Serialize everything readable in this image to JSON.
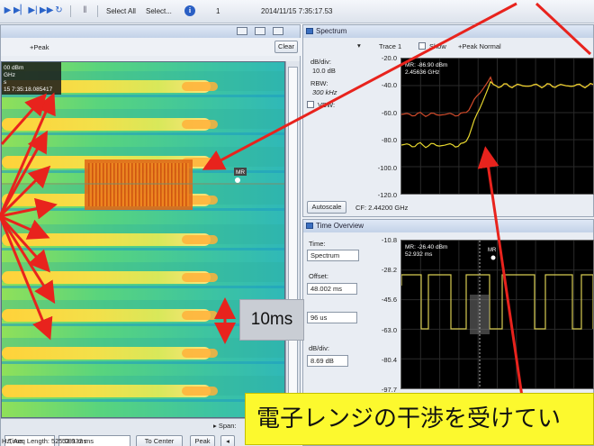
{
  "toolbar": {
    "select_all": "Select All",
    "select": "Select...",
    "index": "1",
    "timestamp": "2014/11/15 7:35:17.53"
  },
  "spectrogram": {
    "peak_label": "+Peak",
    "clear_button": "Clear",
    "marker_readout": [
      "00 dBm",
      "GHz",
      "s",
      "15 7:35:18.085417"
    ],
    "marker_tag": "MR",
    "bottom": {
      "span_label": "▸ Span:",
      "mode_value": "Time",
      "time_value": "52.932 ms",
      "to_center": "To Center",
      "peak_button": "Peak",
      "status": "Hz, Acq Length: 525.081 ms"
    }
  },
  "spectrum": {
    "title": "Spectrum",
    "trace_label": "Trace 1",
    "show_label": "Show",
    "detection": "+Peak Normal",
    "db_div_label": "dB/div:",
    "db_div_value": "10.0 dB",
    "rbw_label": "RBW:",
    "rbw_value": "300 kHz",
    "vbw_label": "VBW:",
    "autoscale_button": "Autoscale",
    "cf_label": "CF: 2.44200 GHz",
    "marker_readout": [
      "MR: -86.90 dBm",
      "2.45636 GHz"
    ],
    "y_ticks": [
      "-20.0",
      "-40.0",
      "-60.0",
      "-80.0",
      "-100.0",
      "-120.0"
    ]
  },
  "time_overview": {
    "title": "Time Overview",
    "time_label": "Time:",
    "time_select": "Spectrum",
    "offset_label": "Offset:",
    "offset_value": "48.002 ms",
    "length_value": "96 us",
    "db_div_label": "dB/div:",
    "db_div_value": "8.69 dB",
    "marker_readout": [
      "MR: -26.40 dBm",
      "52.932 ms"
    ],
    "marker_tag": "MR",
    "y_ticks": [
      "-10.8",
      "-28.2",
      "-45.6",
      "-63.0",
      "-80.4",
      "-97.7"
    ]
  },
  "annotations": {
    "box_text": "10ms",
    "caption": "電子レンジの干渉を受けてい"
  },
  "colors": {
    "arrow": "#e8231d",
    "caption_bg": "#fcf92e",
    "trace_yellow": "#e6d62e",
    "trace_red": "#d04a2a"
  },
  "icons": [
    "play-icon",
    "step-forward-icon",
    "skip-end-icon",
    "loop-icon",
    "pause-icon",
    "info-icon",
    "peak-marker-icon"
  ]
}
